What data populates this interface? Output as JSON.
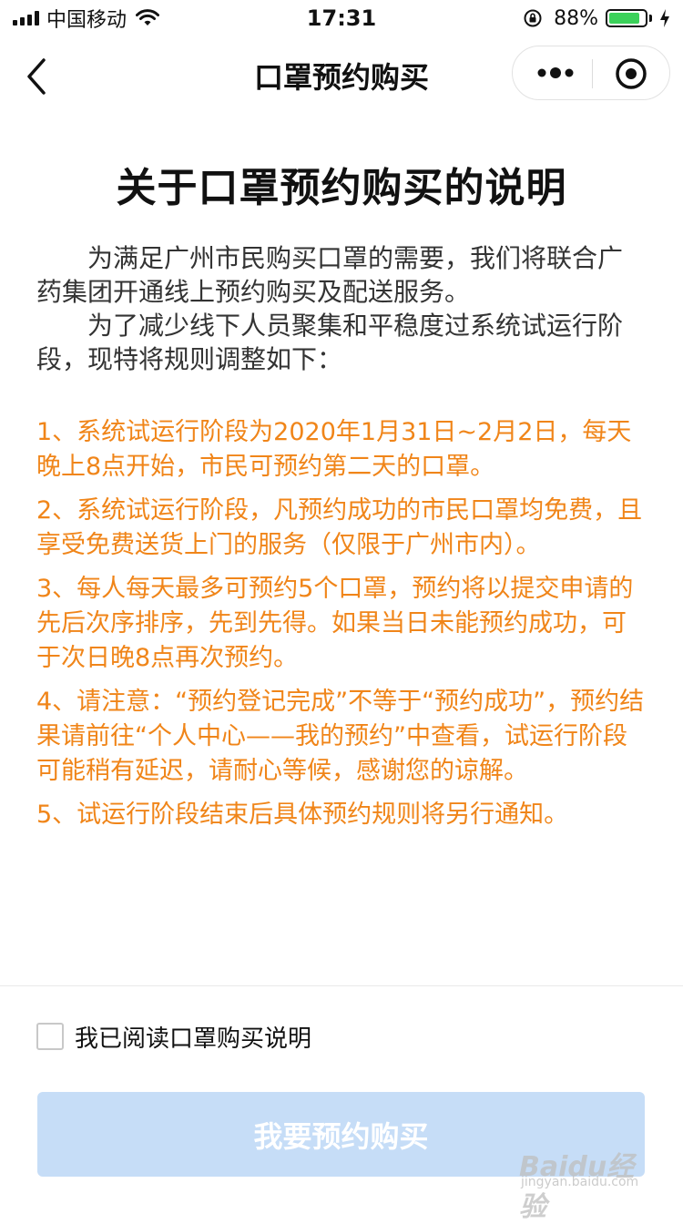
{
  "status_bar": {
    "carrier": "中国移动",
    "time": "17:31",
    "battery_percent": "88%",
    "battery_level": 0.88
  },
  "nav": {
    "title": "口罩预约购买"
  },
  "content": {
    "title": "关于口罩预约购买的说明",
    "intro_1": "　　为满足广州市民购买口罩的需要，我们将联合广药集团开通线上预约购买及配送服务。",
    "intro_2": "　　为了减少线下人员聚集和平稳度过系统试运行阶段，现特将规则调整如下：",
    "rules": [
      "1、系统试运行阶段为2020年1月31日~2月2日，每天晚上8点开始，市民可预约第二天的口罩。",
      "2、系统试运行阶段，凡预约成功的市民口罩均免费，且享受免费送货上门的服务（仅限于广州市内）。",
      "3、每人每天最多可预约5个口罩，预约将以提交申请的先后次序排序，先到先得。如果当日未能预约成功，可于次日晚8点再次预约。",
      "4、请注意：“预约登记完成”不等于“预约成功”，预约结果请前往“个人中心——我的预约”中查看，试运行阶段可能稍有延迟，请耐心等候，感谢您的谅解。",
      "5、试运行阶段结束后具体预约规则将另行通知。"
    ]
  },
  "agreement": {
    "label": "我已阅读口罩购买说明",
    "checked": false
  },
  "submit": {
    "label": "我要预约购买"
  },
  "watermark": {
    "text": "Baidu经验",
    "sub": "jingyan.baidu.com"
  },
  "colors": {
    "accent_orange": "#f08519",
    "button_disabled": "#c6ddf7",
    "battery_green": "#3bd15a"
  }
}
